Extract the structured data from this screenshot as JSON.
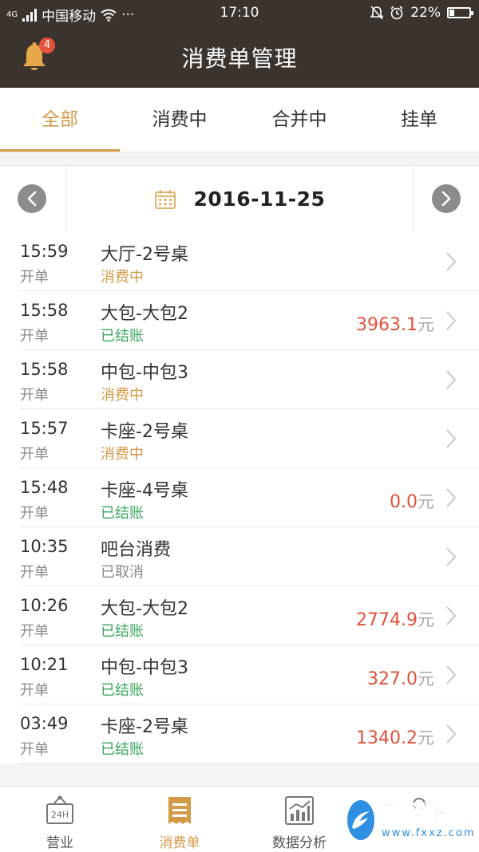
{
  "status_bar": {
    "network": "4G",
    "carrier": "中国移动",
    "dots": "···",
    "time": "17:10",
    "battery": "22%"
  },
  "header": {
    "title": "消费单管理",
    "notification_count": "4"
  },
  "tabs": [
    {
      "label": "全部",
      "active": true
    },
    {
      "label": "消费中",
      "active": false
    },
    {
      "label": "合并中",
      "active": false
    },
    {
      "label": "挂单",
      "active": false
    }
  ],
  "date_selector": {
    "date": "2016-11-25"
  },
  "orders": [
    {
      "time": "15:59",
      "type": "开单",
      "table": "大厅-2号桌",
      "status": "消费中",
      "status_kind": "consuming",
      "amount": "",
      "unit": ""
    },
    {
      "time": "15:58",
      "type": "开单",
      "table": "大包-大包2",
      "status": "已结账",
      "status_kind": "paid",
      "amount": "3963.1",
      "unit": "元"
    },
    {
      "time": "15:58",
      "type": "开单",
      "table": "中包-中包3",
      "status": "消费中",
      "status_kind": "consuming",
      "amount": "",
      "unit": ""
    },
    {
      "time": "15:57",
      "type": "开单",
      "table": "卡座-2号桌",
      "status": "消费中",
      "status_kind": "consuming",
      "amount": "",
      "unit": ""
    },
    {
      "time": "15:48",
      "type": "开单",
      "table": "卡座-4号桌",
      "status": "已结账",
      "status_kind": "paid",
      "amount": "0.0",
      "unit": "元"
    },
    {
      "time": "10:35",
      "type": "开单",
      "table": "吧台消费",
      "status": "已取消",
      "status_kind": "cancel",
      "amount": "",
      "unit": ""
    },
    {
      "time": "10:26",
      "type": "开单",
      "table": "大包-大包2",
      "status": "已结账",
      "status_kind": "paid",
      "amount": "2774.9",
      "unit": "元"
    },
    {
      "time": "10:21",
      "type": "开单",
      "table": "中包-中包3",
      "status": "已结账",
      "status_kind": "paid",
      "amount": "327.0",
      "unit": "元"
    },
    {
      "time": "03:49",
      "type": "开单",
      "table": "卡座-2号桌",
      "status": "已结账",
      "status_kind": "paid",
      "amount": "1340.2",
      "unit": "元"
    }
  ],
  "bottom_nav": [
    {
      "label": "营业",
      "icon": "business-24h-icon",
      "active": false
    },
    {
      "label": "消费单",
      "icon": "receipt-icon",
      "active": true
    },
    {
      "label": "数据分析",
      "icon": "chart-icon",
      "active": false
    }
  ],
  "watermark": {
    "text": "飞翔下载",
    "url": "www.fxxz.com"
  },
  "colors": {
    "header_bg": "#3a332e",
    "accent": "#d39a47",
    "paid": "#3aa65c",
    "amount": "#e0523a"
  }
}
